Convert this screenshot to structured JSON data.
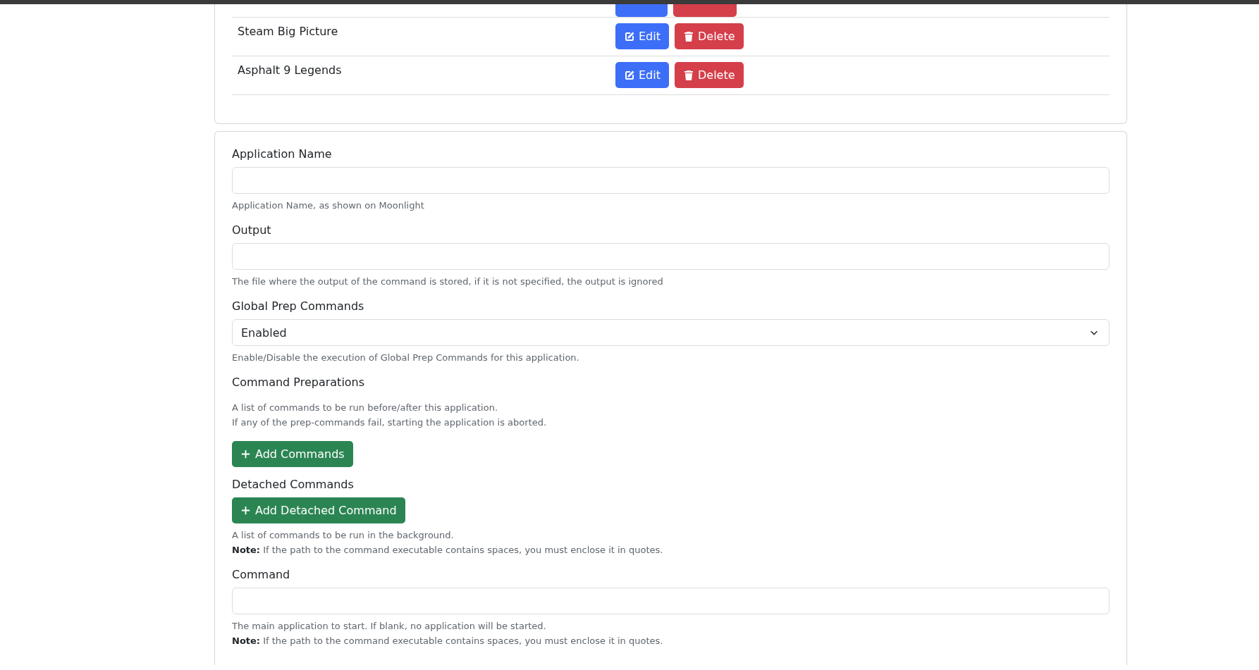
{
  "apps": [
    {
      "name": "Steam Big Picture",
      "edit": "Edit",
      "delete": "Delete"
    },
    {
      "name": "Asphalt 9 Legends",
      "edit": "Edit",
      "delete": "Delete"
    }
  ],
  "form": [
    {
      "kind": "input",
      "label": "Application Name",
      "help": [
        "Application Name, as shown on Moonlight"
      ]
    },
    {
      "kind": "input",
      "label": "Output",
      "help": [
        "The file where the output of the command is stored, if it is not specified, the output is ignored"
      ]
    },
    {
      "kind": "select",
      "label": "Global Prep Commands",
      "value": "Enabled",
      "help": [
        "Enable/Disable the execution of Global Prep Commands for this application."
      ]
    },
    {
      "kind": "button-after-help",
      "label": "Command Preparations",
      "button": "Add Commands",
      "help": [
        "A list of commands to be run before/after this application.",
        "If any of the prep-commands fail, starting the application is aborted."
      ]
    },
    {
      "kind": "button",
      "label": "Detached Commands",
      "button": "Add Detached Command",
      "help": [
        "A list of commands to be run in the background.",
        "**Note:** If the path to the command executable contains spaces, you must enclose it in quotes."
      ]
    },
    {
      "kind": "input",
      "label": "Command",
      "help": [
        "The main application to start. If blank, no application will be started.",
        "**Note:** If the path to the command executable contains spaces, you must enclose it in quotes."
      ]
    }
  ]
}
